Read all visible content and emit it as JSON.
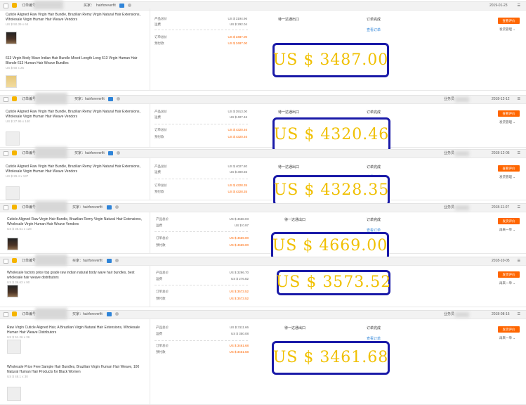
{
  "header_labels": {
    "order_no": "订单编号",
    "buyer": "买家：",
    "seller_label": "业务员"
  },
  "amount_labels": {
    "product_total": "产品总价",
    "shipping": "运费",
    "order_amount": "订单总价",
    "prepaid": "预付款"
  },
  "ship_method": "待一达通出口",
  "status_text": "订单完成",
  "view_order": "查看订单",
  "btn_reviews": "查看评价",
  "btn_review_pending": "发货评价",
  "ship_manage": "发货管理",
  "more_actions": "再来一单",
  "orders": [
    {
      "buyer": "hairforeverfit",
      "date": "2019-01-23",
      "products": [
        {
          "title": "Cuticle Aligned Raw Virgin Hair Bundle, Brazilian Remy Virgin Natural Hair Extensions, Wholesale Virgin Human Hair Weave Vendors",
          "size": "US $ 50.39 x 64"
        },
        {
          "title": "613 Virgin Body Wave Indian Hair Bundle Mixed Length Long 613 Virgin Human Hair Blonde 613 Human Hair Weave Bundles",
          "size": "US $ 50 x 25"
        }
      ],
      "product_total": "US $ 3194.96",
      "shipping": "US $ 292.04",
      "order_amount": "US $ 3487.00",
      "prepaid": "US $ 3487.00",
      "big_price": "US $ 3487.00"
    },
    {
      "buyer": "hairforeverfit",
      "date": "2018-12-12",
      "products": [
        {
          "title": "Cuticle Aligned Raw Virgin Hair Bundle, Brazilian Remy Virgin Natural Hair Extensions, Wholesale Virgin Human Hair Weave Vendors",
          "size": "US $ 27.95 x 140"
        }
      ],
      "product_total": "US $ 3913.00",
      "shipping": "US $ 407.46",
      "order_amount": "US $ 4320.46",
      "prepaid": "US $ 4320.46",
      "big_price": "US $ 4320.46"
    },
    {
      "buyer": "hairforeverfit",
      "date": "2018-12-05",
      "products": [
        {
          "title": "Cuticle Aligned Raw Virgin Hair Bundle, Brazilian Remy Virgin Natural Hair Extensions, Wholesale Virgin Human Hair Weave Vendors",
          "size": "US $ 29.4 x 137"
        }
      ],
      "product_total": "US $ 4027.80",
      "shipping": "US $ 300.55",
      "order_amount": "US $ 4328.35",
      "prepaid": "US $ 4328.35",
      "big_price": "US $ 4328.35"
    },
    {
      "buyer": "hairforeverfit",
      "date": "2018-11-07",
      "products": [
        {
          "title": "Cuticle Aligned Raw Virgin Hair Bundle, Brazilian Remy Virgin Natural Hair Extensions, Wholesale Virgin Human Hair Weave Vendors",
          "size": "US $ 36.51 x 128"
        }
      ],
      "product_total": "US $ 4668.03",
      "shipping": "US $ 0.97",
      "order_amount": "US $ 4669.00",
      "prepaid": "US $ 4669.00",
      "big_price": "US $ 4669.00"
    },
    {
      "buyer": "hairforeverfit",
      "date": "2018-10-05",
      "products": [
        {
          "title": "Wholesale factory price top grade raw indian natural body wave hair bundles, best wholesale hair weave distributors",
          "size": "US $ 36.63 x 90"
        }
      ],
      "product_total": "US $ 3296.70",
      "shipping": "US $ 276.82",
      "order_amount": "US $ 3573.52",
      "prepaid": "US $ 3573.52",
      "big_price": "US $ 3573.52"
    },
    {
      "buyer": "hairforeverfit",
      "date": "2018-08-16",
      "products": [
        {
          "title": "Raw Virgin Cuticle Aligned Hair, A Brazilian Virgin Natural Hair Extensions, Wholesale Human Hair Weave Distributors",
          "size": "US $ 51.26 x 36"
        },
        {
          "title": "Wholesale Price Free Sample Hair Bundles, Brazilian Virgin Human Hair Weave, 100 Natural Human Hair Products for Black Women",
          "size": "US $ 48.1 x 30"
        }
      ],
      "product_total": "US $ 3111.66",
      "shipping": "US $ 350.08",
      "order_amount": "US $ 3461.68",
      "prepaid": "US $ 3461.68",
      "big_price": "US $ 3461.68"
    }
  ]
}
